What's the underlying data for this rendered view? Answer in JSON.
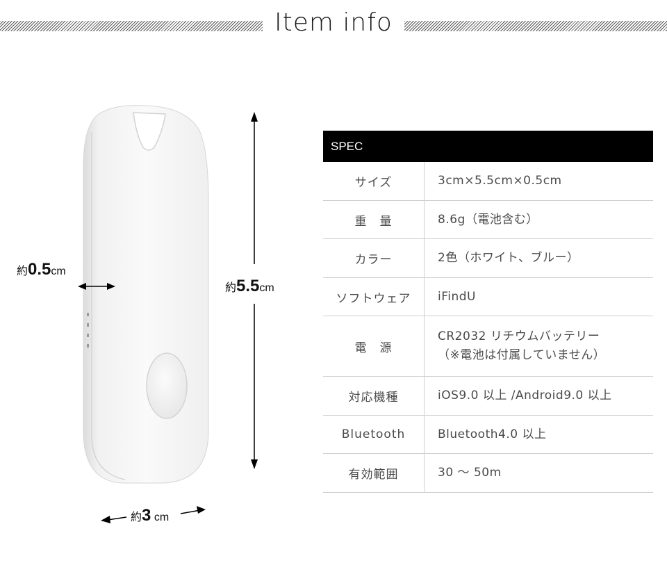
{
  "header": {
    "title": "Item info"
  },
  "product": {
    "image_alt": "white-bluetooth-tracker-tag",
    "dimensions": {
      "depth": {
        "prefix": "約",
        "value": "0.5",
        "unit": "cm"
      },
      "height": {
        "prefix": "約",
        "value": "5.5",
        "unit": "cm"
      },
      "width": {
        "prefix": "約",
        "value": "3",
        "unit": "cm"
      }
    }
  },
  "spec": {
    "heading": "SPEC",
    "rows": [
      {
        "label": "サイズ",
        "value": [
          "3cm×5.5cm×0.5cm"
        ]
      },
      {
        "label": "重　量",
        "value": [
          "8.6g（電池含む）"
        ]
      },
      {
        "label": "カラー",
        "value": [
          "2色（ホワイト、ブルー）"
        ]
      },
      {
        "label": "ソフトウェア",
        "value": [
          "iFindU"
        ]
      },
      {
        "label": "電　源",
        "value": [
          "CR2032 リチウムバッテリー",
          "（※電池は付属していません）"
        ]
      },
      {
        "label": "対応機種",
        "value": [
          "iOS9.0 以上 /Android9.0 以上"
        ]
      },
      {
        "label": "Bluetooth",
        "value": [
          "Bluetooth4.0 以上"
        ]
      },
      {
        "label": "有効範囲",
        "value": [
          "30 ～ 50m"
        ]
      }
    ]
  }
}
